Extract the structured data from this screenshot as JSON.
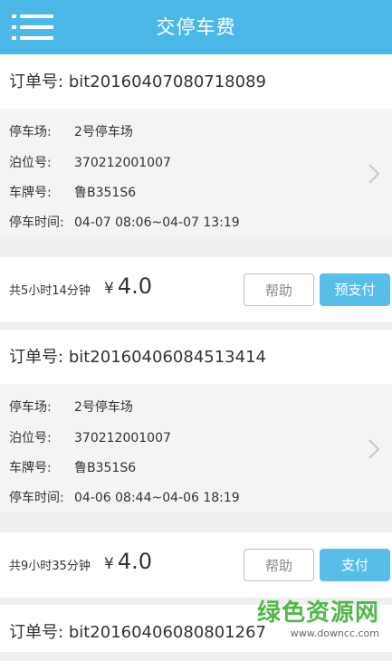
{
  "header": {
    "title": "交停车费",
    "menu_icon": "hamburger-menu-icon"
  },
  "orders": [
    {
      "order_label": "订单号:",
      "order_no": "bit20160407080718089",
      "fields": [
        {
          "label": "停车场:",
          "value": "2号停车场"
        },
        {
          "label": "泊位号:",
          "value": "370212001007"
        },
        {
          "label": "车牌号:",
          "value": "鲁B351S6"
        },
        {
          "label": "停车时间:",
          "value": "04-07 08:06~04-07 13:19"
        }
      ],
      "duration": "共5小时14分钟",
      "currency": "¥",
      "amount": "4.0",
      "help_label": "帮助",
      "pay_label": "预支付"
    },
    {
      "order_label": "订单号:",
      "order_no": "bit20160406084513414",
      "fields": [
        {
          "label": "停车场:",
          "value": "2号停车场"
        },
        {
          "label": "泊位号:",
          "value": "370212001007"
        },
        {
          "label": "车牌号:",
          "value": "鲁B351S6"
        },
        {
          "label": "停车时间:",
          "value": "04-06 08:44~04-06 18:19"
        }
      ],
      "duration": "共9小时35分钟",
      "currency": "¥",
      "amount": "4.0",
      "help_label": "帮助",
      "pay_label": "支付"
    },
    {
      "order_label": "订单号:",
      "order_no": "bit20160406080801267"
    }
  ],
  "watermark": {
    "text": "绿色资源网",
    "url": "www.downcc.com"
  },
  "colors": {
    "accent": "#4cb8e8",
    "pay_button": "#57bde9",
    "watermark": "#53b84b"
  }
}
